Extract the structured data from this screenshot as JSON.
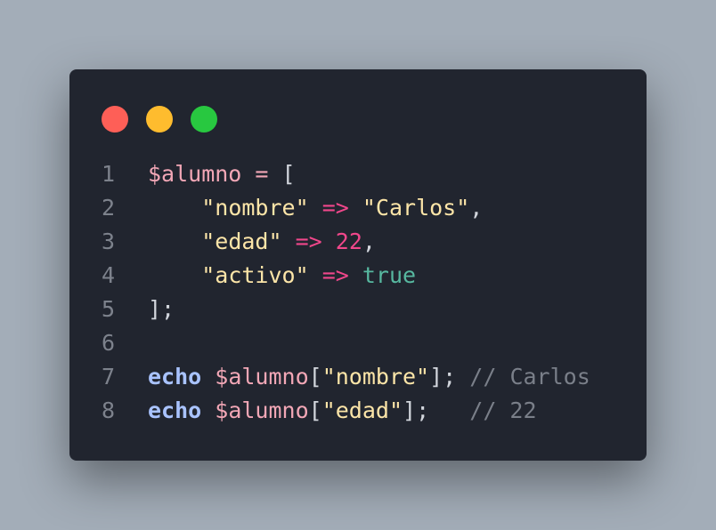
{
  "window": {
    "controls": {
      "close": "red-dot",
      "minimize": "yellow-dot",
      "maximize": "green-dot"
    }
  },
  "colors": {
    "background": "#a3adb8",
    "editor_bg": "#21252f",
    "line_number": "#7d828c",
    "variable": "#f2a7b6",
    "string": "#fce5a8",
    "arrow": "#f0478b",
    "number": "#f0478b",
    "boolean": "#57b8a0",
    "keyword": "#a9c3ff",
    "comment": "#7a7f89"
  },
  "code": {
    "lines": [
      {
        "num": "1",
        "tokens": [
          {
            "t": "$alumno",
            "c": "var"
          },
          {
            "t": " ",
            "c": "punc"
          },
          {
            "t": "=",
            "c": "op"
          },
          {
            "t": " [",
            "c": "punc"
          }
        ]
      },
      {
        "num": "2",
        "tokens": [
          {
            "t": "    ",
            "c": "punc"
          },
          {
            "t": "\"nombre\"",
            "c": "str"
          },
          {
            "t": " ",
            "c": "punc"
          },
          {
            "t": "=>",
            "c": "arrow"
          },
          {
            "t": " ",
            "c": "punc"
          },
          {
            "t": "\"Carlos\"",
            "c": "str"
          },
          {
            "t": ",",
            "c": "punc"
          }
        ]
      },
      {
        "num": "3",
        "tokens": [
          {
            "t": "    ",
            "c": "punc"
          },
          {
            "t": "\"edad\"",
            "c": "str"
          },
          {
            "t": " ",
            "c": "punc"
          },
          {
            "t": "=>",
            "c": "arrow"
          },
          {
            "t": " ",
            "c": "punc"
          },
          {
            "t": "22",
            "c": "num"
          },
          {
            "t": ",",
            "c": "punc"
          }
        ]
      },
      {
        "num": "4",
        "tokens": [
          {
            "t": "    ",
            "c": "punc"
          },
          {
            "t": "\"activo\"",
            "c": "str"
          },
          {
            "t": " ",
            "c": "punc"
          },
          {
            "t": "=>",
            "c": "arrow"
          },
          {
            "t": " ",
            "c": "punc"
          },
          {
            "t": "true",
            "c": "bool"
          }
        ]
      },
      {
        "num": "5",
        "tokens": [
          {
            "t": "];",
            "c": "punc"
          }
        ]
      },
      {
        "num": "6",
        "tokens": []
      },
      {
        "num": "7",
        "tokens": [
          {
            "t": "echo",
            "c": "kw"
          },
          {
            "t": " ",
            "c": "punc"
          },
          {
            "t": "$alumno",
            "c": "var"
          },
          {
            "t": "[",
            "c": "punc"
          },
          {
            "t": "\"nombre\"",
            "c": "str"
          },
          {
            "t": "];",
            "c": "punc"
          },
          {
            "t": " ",
            "c": "punc"
          },
          {
            "t": "// Carlos",
            "c": "cmt"
          }
        ]
      },
      {
        "num": "8",
        "tokens": [
          {
            "t": "echo",
            "c": "kw"
          },
          {
            "t": " ",
            "c": "punc"
          },
          {
            "t": "$alumno",
            "c": "var"
          },
          {
            "t": "[",
            "c": "punc"
          },
          {
            "t": "\"edad\"",
            "c": "str"
          },
          {
            "t": "];",
            "c": "punc"
          },
          {
            "t": "   ",
            "c": "punc"
          },
          {
            "t": "// 22",
            "c": "cmt"
          }
        ]
      }
    ]
  }
}
